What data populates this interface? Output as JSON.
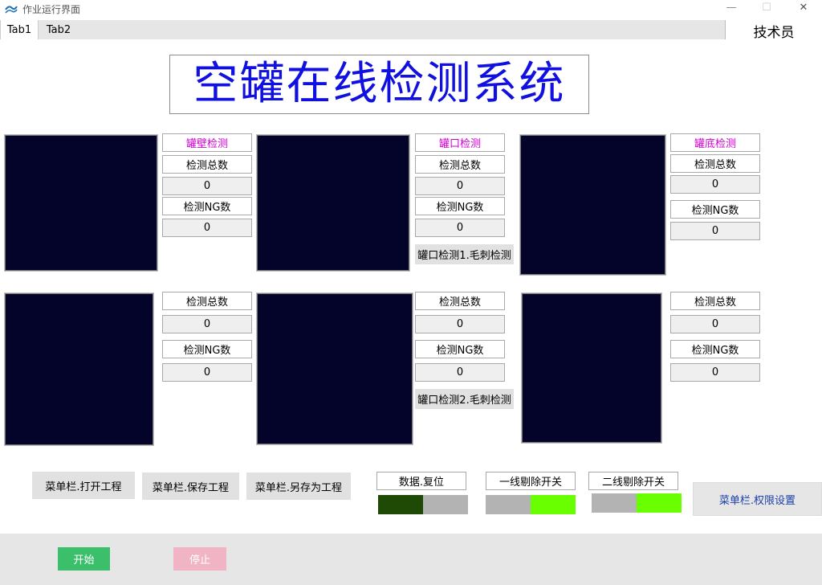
{
  "window": {
    "title": "作业运行界面",
    "minimize": "—",
    "maximize": "☐",
    "close": "✕"
  },
  "tabs": [
    {
      "label": "Tab1"
    },
    {
      "label": "Tab2"
    }
  ],
  "role": "技术员",
  "main_title": "空罐在线检测系统",
  "panels": {
    "p1": {
      "header": "罐壁检测",
      "total_label": "检测总数",
      "total": "0",
      "ng_label": "检测NG数",
      "ng": "0"
    },
    "p2": {
      "header": "罐口检测",
      "total_label": "检测总数",
      "total": "0",
      "ng_label": "检测NG数",
      "ng": "0",
      "sub_button": "罐口检测1.毛刺检测"
    },
    "p3": {
      "header": "罐底检测",
      "total_label": "检测总数",
      "total": "0",
      "ng_label": "检测NG数",
      "ng": "0"
    },
    "p4": {
      "total_label": "检测总数",
      "total": "0",
      "ng_label": "检测NG数",
      "ng": "0"
    },
    "p5": {
      "total_label": "检测总数",
      "total": "0",
      "ng_label": "检测NG数",
      "ng": "0",
      "sub_button": "罐口检测2.毛刺检测"
    },
    "p6": {
      "total_label": "检测总数",
      "total": "0",
      "ng_label": "检测NG数",
      "ng": "0"
    }
  },
  "menu_buttons": {
    "open": "菜单栏.打开工程",
    "save": "菜单栏.保存工程",
    "save_as": "菜单栏.另存为工程",
    "permissions": "菜单栏.权限设置"
  },
  "toggles": {
    "reset": {
      "label": "数据.复位",
      "state": "off"
    },
    "line1": {
      "label": "一线剔除开关",
      "state": "on"
    },
    "line2": {
      "label": "二线剔除开关",
      "state": "on"
    }
  },
  "colors": {
    "toggle_off_dark": "#1f4a06",
    "toggle_gray": "#b3b3b3",
    "toggle_on": "#6aff00",
    "title_blue": "#1010e0",
    "view_bg": "#04032a"
  },
  "actions": {
    "start": "开始",
    "stop": "停止"
  }
}
